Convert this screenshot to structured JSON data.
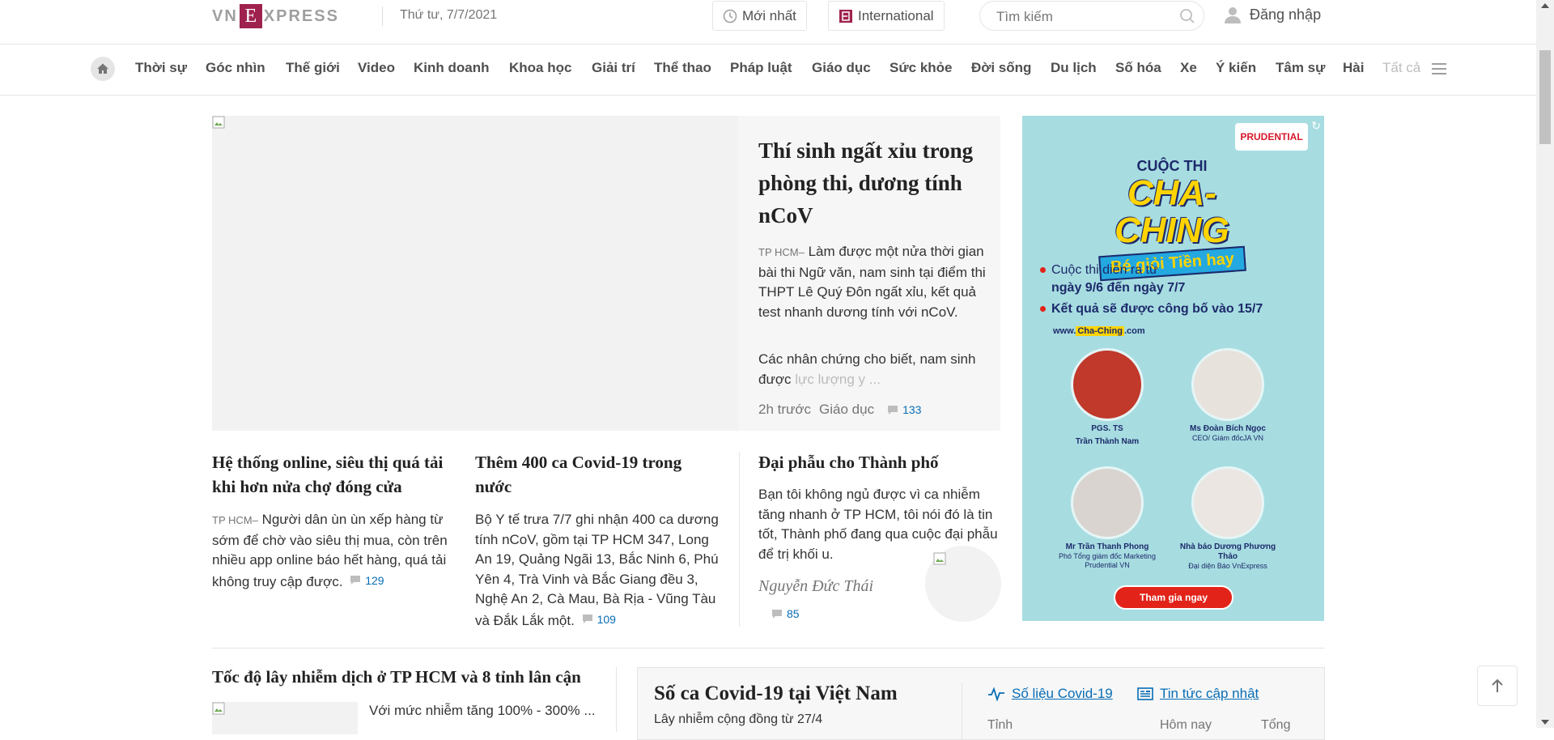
{
  "header": {
    "logo_left": "VN",
    "logo_box": "E",
    "logo_right": "XPRESS",
    "date": "Thứ tư, 7/7/2021",
    "latest_label": "Mới nhất",
    "international_label": "International",
    "search_placeholder": "Tìm kiếm",
    "login_label": "Đăng nhập"
  },
  "nav": {
    "items": [
      "Thời sự",
      "Góc nhìn",
      "Thế giới",
      "Video",
      "Kinh doanh",
      "Khoa học",
      "Giải trí",
      "Thể thao",
      "Pháp luật",
      "Giáo dục",
      "Sức khỏe",
      "Đời sống",
      "Du lịch",
      "Số hóa",
      "Xe",
      "Ý kiến",
      "Tâm sự",
      "Hài"
    ],
    "all_label": "Tất cả"
  },
  "top_story": {
    "title": "Thí sinh ngất xỉu trong phòng thi, dương tính nCoV",
    "location": "TP HCM–",
    "description": "Làm được một nửa thời gian bài thi Ngữ văn, nam sinh tại điểm thi THPT Lê Quý Đôn ngất xỉu, kết quả test nhanh dương tính với nCoV.",
    "excerpt_visible": "Các nhân chứng cho biết, nam sinh được ",
    "excerpt_faded": "lực lượng y ...",
    "time": "2h trước",
    "category": "Giáo dục",
    "comments": "133"
  },
  "articles": [
    {
      "title": "Hệ thống online, siêu thị quá tải khi hơn nửa chợ đóng cửa",
      "location": "TP HCM–",
      "description": "Người dân ùn ùn xếp hàng từ sớm để chờ vào siêu thị mua, còn trên nhiều app online báo hết hàng, quá tải không truy cập được.",
      "comments": "129"
    },
    {
      "title": "Thêm 400 ca Covid-19 trong nước",
      "description": "Bộ Y tế trưa 7/7 ghi nhận 400 ca dương tính nCoV, gồm tại TP HCM 347, Long An 19, Quảng Ngãi 13, Bắc Ninh 6, Phú Yên 4, Trà Vinh và Bắc Giang đều 3, Nghệ An 2, Cà Mau, Bà Rịa - Vũng Tàu và Đắk Lắk một.",
      "comments": "109"
    },
    {
      "title": "Đại phẫu cho Thành phố",
      "description": "Bạn tôi không ngủ được vì ca nhiễm tăng nhanh ở TP HCM, tôi nói đó là tin tốt, Thành phố đang qua cuộc đại phẫu để trị khối u.",
      "author": "Nguyễn Đức Thái",
      "comments": "85"
    }
  ],
  "ad": {
    "brand": "PRUDENTIAL",
    "contest_line1": "CUỘC THI",
    "contest_line2": "CHA-CHING",
    "contest_line3": "Bé giỏi Tiền hay",
    "bullet1_a": "Cuộc thi diễn ra từ",
    "bullet1_b": "ngày 9/6 đến ngày 7/7",
    "bullet2": "Kết quả sẽ được công bố vào 15/7",
    "site_prefix": "www.",
    "site_highlight": "Cha-Ching",
    "site_suffix": ".com",
    "people": [
      {
        "name": "PGS. TS",
        "name2": "Trần Thành Nam",
        "role": ""
      },
      {
        "name": "Ms Đoàn Bích Ngọc",
        "name2": "",
        "role": "CEO/ Giám đốcJA VN"
      },
      {
        "name": "Mr Trần Thanh Phong",
        "name2": "",
        "role": "Phó Tổng giám đốc Marketing Prudential VN"
      },
      {
        "name": "Nhà báo Dương Phương Thảo",
        "name2": "",
        "role": "Đại diện Báo VnExpress"
      }
    ],
    "cta": "Tham gia ngay"
  },
  "bottom": {
    "article_title": "Tốc độ lây nhiễm dịch ở TP HCM và 8 tỉnh lân cận",
    "article_desc": "Với mức nhiễm tăng 100% - 300% ...",
    "covid_title": "Số ca Covid-19 tại Việt Nam",
    "covid_subtitle": "Lây nhiễm cộng đồng từ 27/4",
    "link_stats": "Số liệu Covid-19",
    "link_news": "Tin tức cập nhật",
    "col_province": "Tỉnh",
    "col_today": "Hôm nay",
    "col_total": "Tổng"
  },
  "colors": {
    "brand": "#9f224e",
    "link": "#076db6",
    "ad_bg": "#a7dde1"
  }
}
